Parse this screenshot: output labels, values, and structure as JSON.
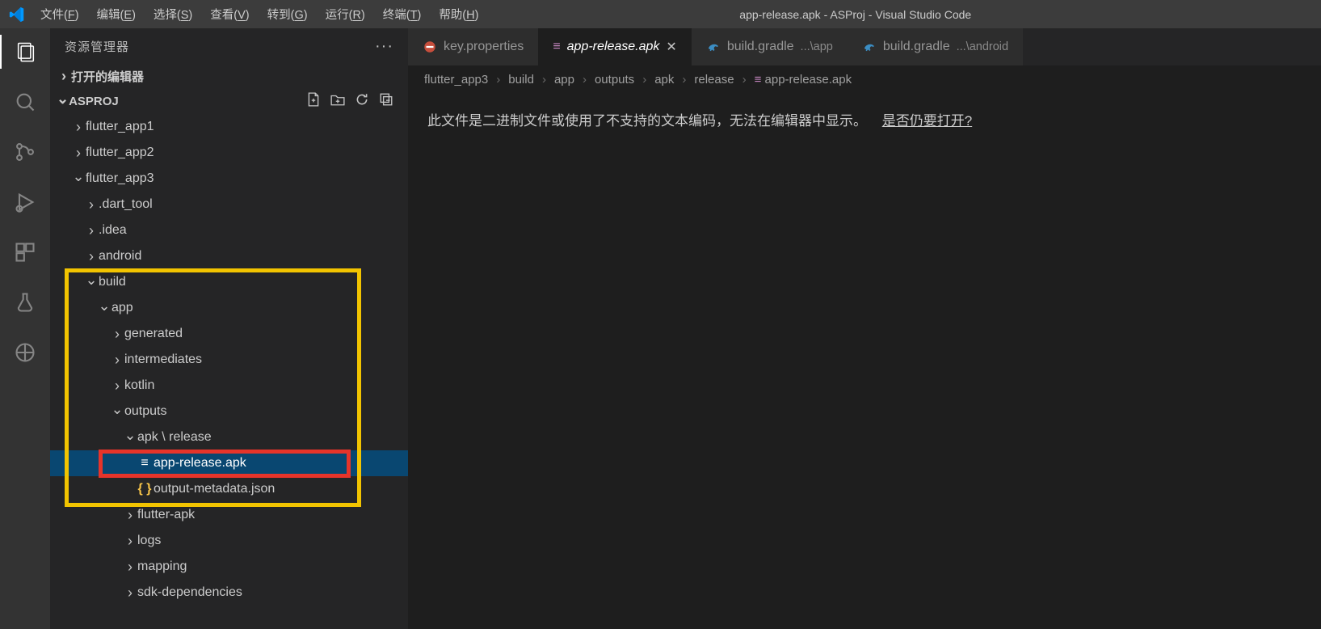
{
  "titlebar": {
    "menus": [
      {
        "label": "文件",
        "mn": "F"
      },
      {
        "label": "编辑",
        "mn": "E"
      },
      {
        "label": "选择",
        "mn": "S"
      },
      {
        "label": "查看",
        "mn": "V"
      },
      {
        "label": "转到",
        "mn": "G"
      },
      {
        "label": "运行",
        "mn": "R"
      },
      {
        "label": "终端",
        "mn": "T"
      },
      {
        "label": "帮助",
        "mn": "H"
      }
    ],
    "title": "app-release.apk - ASProj - Visual Studio Code"
  },
  "sidebar": {
    "title": "资源管理器",
    "open_editors": "打开的编辑器",
    "project": "ASPROJ",
    "tree": [
      {
        "indent": 1,
        "kind": "folder",
        "expand": "closed",
        "label": "flutter_app1"
      },
      {
        "indent": 1,
        "kind": "folder",
        "expand": "closed",
        "label": "flutter_app2"
      },
      {
        "indent": 1,
        "kind": "folder",
        "expand": "open",
        "label": "flutter_app3"
      },
      {
        "indent": 2,
        "kind": "folder",
        "expand": "closed",
        "label": ".dart_tool"
      },
      {
        "indent": 2,
        "kind": "folder",
        "expand": "closed",
        "label": ".idea"
      },
      {
        "indent": 2,
        "kind": "folder",
        "expand": "closed",
        "label": "android"
      },
      {
        "indent": 2,
        "kind": "folder",
        "expand": "open",
        "label": "build"
      },
      {
        "indent": 3,
        "kind": "folder",
        "expand": "open",
        "label": "app"
      },
      {
        "indent": 4,
        "kind": "folder",
        "expand": "closed",
        "label": "generated"
      },
      {
        "indent": 4,
        "kind": "folder",
        "expand": "closed",
        "label": "intermediates"
      },
      {
        "indent": 4,
        "kind": "folder",
        "expand": "closed",
        "label": "kotlin"
      },
      {
        "indent": 4,
        "kind": "folder",
        "expand": "open",
        "label": "outputs"
      },
      {
        "indent": 5,
        "kind": "folder",
        "expand": "open",
        "label": "apk \\ release"
      },
      {
        "indent": 6,
        "kind": "file",
        "icon": "lines",
        "label": "app-release.apk",
        "selected": true
      },
      {
        "indent": 6,
        "kind": "file",
        "icon": "json",
        "label": "output-metadata.json"
      },
      {
        "indent": 5,
        "kind": "folder",
        "expand": "closed",
        "label": "flutter-apk"
      },
      {
        "indent": 5,
        "kind": "folder",
        "expand": "closed",
        "label": "logs"
      },
      {
        "indent": 5,
        "kind": "folder",
        "expand": "closed",
        "label": "mapping"
      },
      {
        "indent": 5,
        "kind": "folder",
        "expand": "closed",
        "label": "sdk-dependencies"
      }
    ]
  },
  "tabs": [
    {
      "icon": "no-entry",
      "label": "key.properties",
      "active": false
    },
    {
      "icon": "lines",
      "label": "app-release.apk",
      "active": true,
      "italic": true,
      "closable": true
    },
    {
      "icon": "gradle",
      "label": "build.gradle",
      "suffix": "...\\app",
      "active": false
    },
    {
      "icon": "gradle",
      "label": "build.gradle",
      "suffix": "...\\android",
      "active": false
    }
  ],
  "breadcrumbs": [
    "flutter_app3",
    "build",
    "app",
    "outputs",
    "apk",
    "release"
  ],
  "breadcrumb_file": {
    "icon": "lines",
    "label": "app-release.apk"
  },
  "editor": {
    "message": "此文件是二进制文件或使用了不支持的文本编码，无法在编辑器中显示。",
    "link": "是否仍要打开?"
  }
}
